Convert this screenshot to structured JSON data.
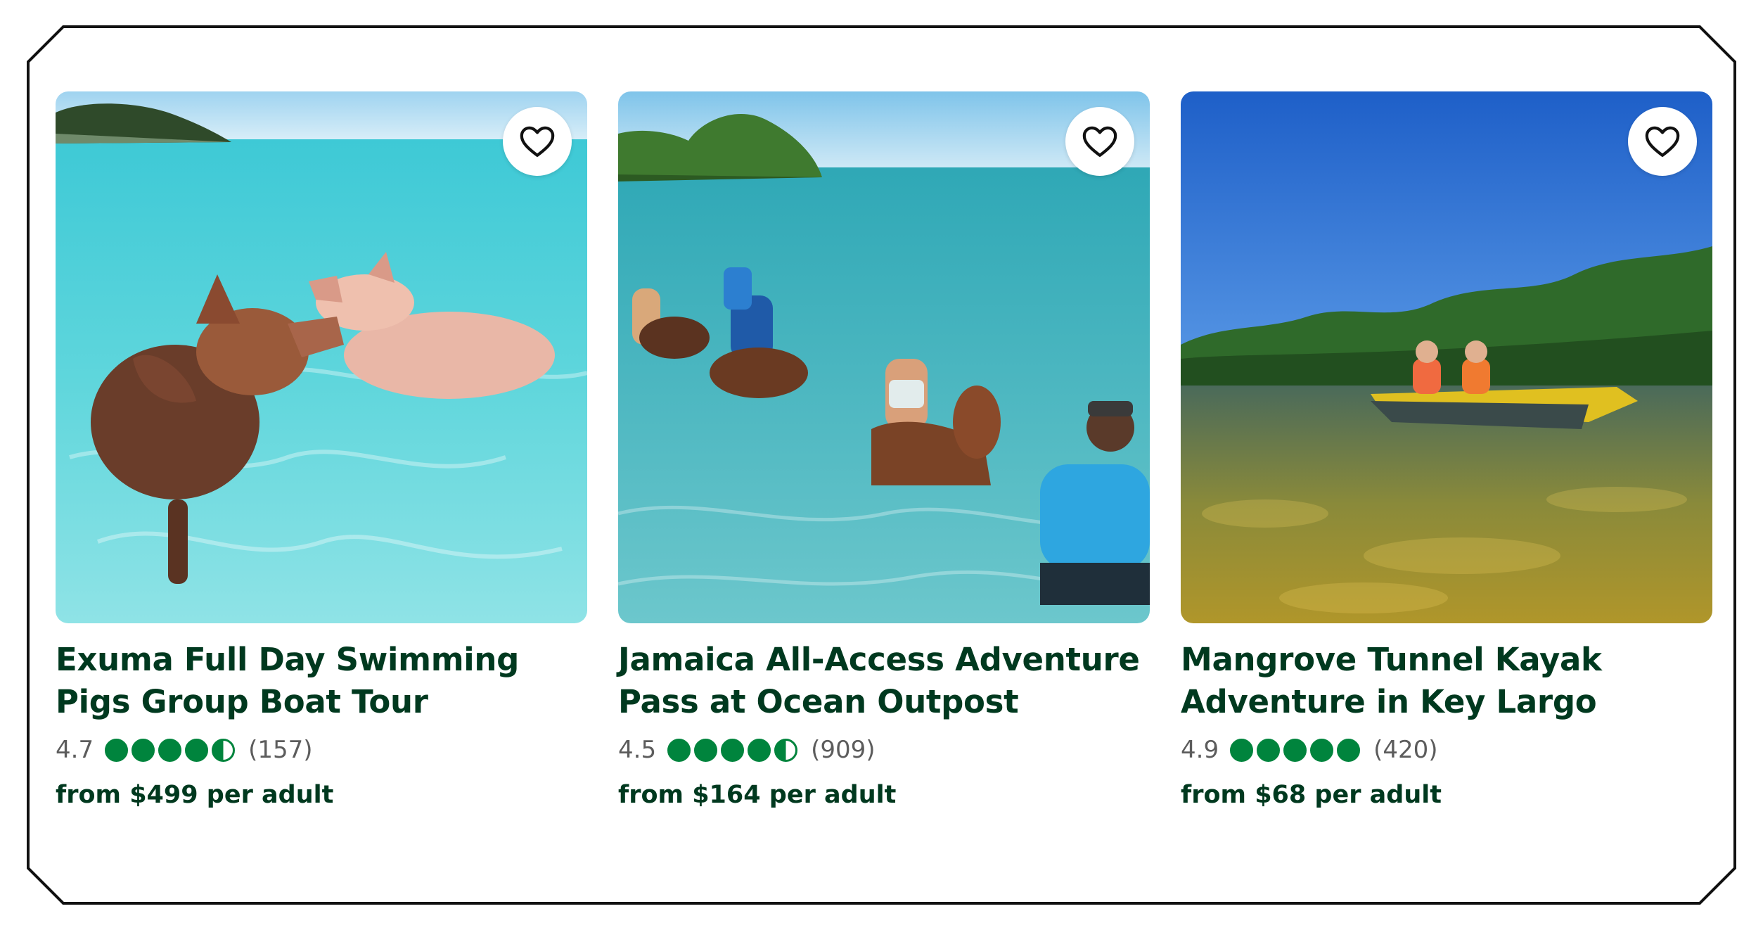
{
  "colors": {
    "title": "#00391f",
    "rating_bubble": "#00843d",
    "rating_text": "#5c5c5c",
    "card_background": "#ffffff"
  },
  "cards": [
    {
      "title": "Exuma Full Day Swimming Pigs Group Boat Tour",
      "rating": "4.7",
      "rating_value": 4.5,
      "reviews": "(157)",
      "price": "from $499 per adult",
      "favorite_icon": "heart-outline-icon"
    },
    {
      "title": "Jamaica All-Access Adventure Pass at Ocean Outpost",
      "rating": "4.5",
      "rating_value": 4.5,
      "reviews": "(909)",
      "price": "from $164 per adult",
      "favorite_icon": "heart-outline-icon"
    },
    {
      "title": "Mangrove Tunnel Kayak Adventure in Key Largo",
      "rating": "4.9",
      "rating_value": 5,
      "reviews": "(420)",
      "price": "from $68 per adult",
      "favorite_icon": "heart-outline-icon"
    }
  ]
}
